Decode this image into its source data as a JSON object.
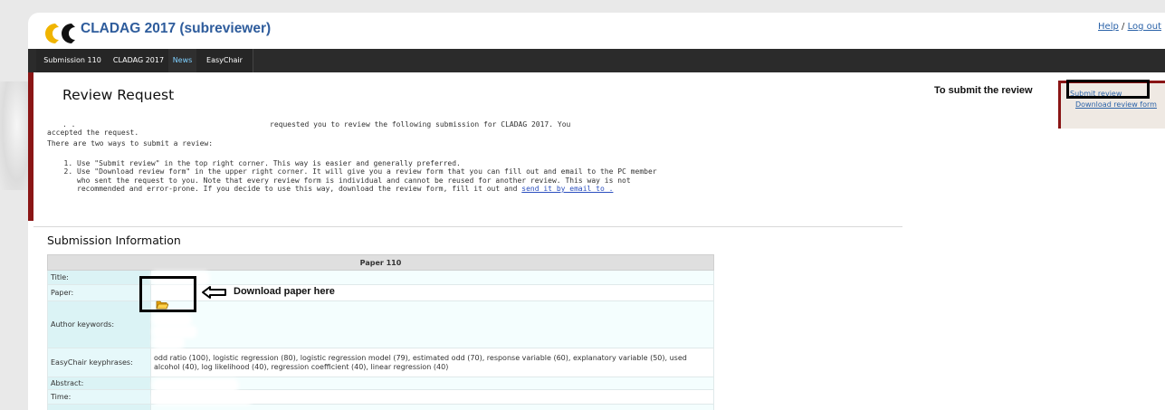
{
  "header": {
    "title": "CLADAG 2017 (subreviewer)",
    "help_label": "Help",
    "separator": "/",
    "logout_label": "Log out"
  },
  "nav": {
    "items": [
      {
        "label": "Submission 110"
      },
      {
        "label": "CLADAG 2017"
      },
      {
        "label": "News"
      },
      {
        "label": "EasyChair"
      }
    ]
  },
  "review": {
    "title": "Review Request",
    "dots": ". .",
    "request_text": "requested you to review the following submission for CLADAG 2017. You",
    "accepted_text": "accepted the request.",
    "ways_text": "There are two ways to submit a review:",
    "step1": "Use \"Submit review\" in the top right corner. This way is easier and generally preferred.",
    "step2_text": "Use \"Download review form\" in the upper right corner. It will give you a review form that you can fill out and email to the PC member who sent the request to you. Note that every review form is individual and cannot be reused for another review. This way is not recommended and error-prone. If you decide to use this way, download the review form, fill it out and ",
    "step2_link": "send it by email to ."
  },
  "sidebar": {
    "annotation": "To submit the review",
    "submit_review": "Submit review",
    "download_review_form": "Download review form"
  },
  "submission": {
    "section_title": "Submission Information",
    "table_header": "Paper 110",
    "labels": {
      "title": "Title:",
      "paper": "Paper:",
      "author_keywords": "Author keywords:",
      "easychair_keyphrases": "EasyChair keyphrases:",
      "abstract": "Abstract:",
      "time": "Time:"
    },
    "keyphrases": "odd ratio (100), logistic regression (80), logistic regression model (79), estimated odd (70), response variable (60), explanatory variable (50), used alcohol (40), log likelihood (40), regression coefficient (40), linear regression (40)",
    "download_note": "Download paper here"
  },
  "colors": {
    "accent_red": "#8a1515",
    "title_blue": "#2e5c9c",
    "nav_bg": "#2b2b2b",
    "table_label_bg": "#dbf3f5"
  },
  "icons": [
    "easychair-logo-icon",
    "folder-icon",
    "left-arrow-icon"
  ]
}
